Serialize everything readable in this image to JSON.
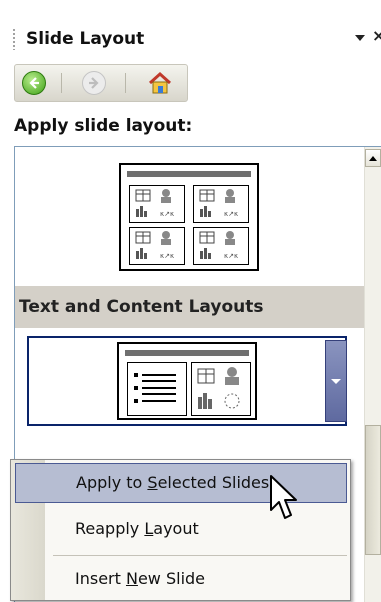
{
  "pane": {
    "title": "Slide Layout",
    "close_glyph": "×"
  },
  "nav": {
    "back_icon": "back-arrow-icon",
    "forward_icon": "forward-arrow-icon",
    "home_icon": "home-icon"
  },
  "apply_label": "Apply slide layout:",
  "layouts": {
    "section_header": "Text and Content Layouts"
  },
  "context_menu": {
    "items": [
      {
        "label_pre": "Apply to ",
        "label_key": "S",
        "label_post": "elected Slides",
        "highlighted": true
      },
      {
        "label_pre": "Reapply ",
        "label_key": "L",
        "label_post": "ayout",
        "highlighted": false
      },
      {
        "label_pre": "Insert ",
        "label_key": "N",
        "label_post": "ew Slide",
        "highlighted": false
      }
    ]
  },
  "colors": {
    "selection_border": "#0a246a",
    "menu_highlight": "#b6bdd2",
    "section_bg": "#d4d0c8"
  }
}
